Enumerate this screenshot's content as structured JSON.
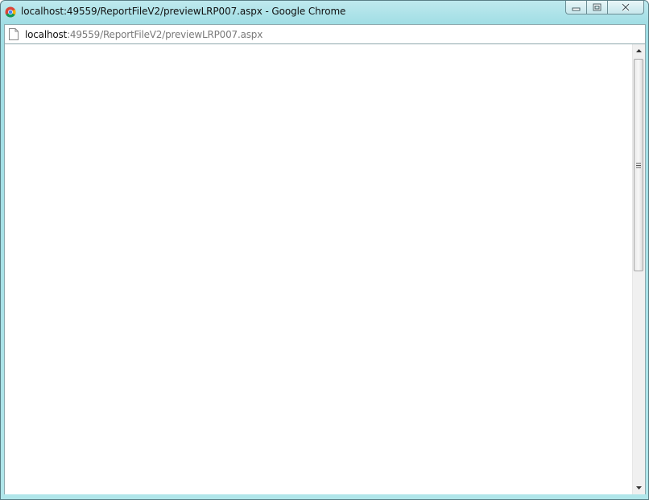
{
  "window": {
    "title": "localhost:49559/ReportFileV2/previewLRP007.aspx - Google Chrome",
    "app_icon": "chrome-logo-icon",
    "caption_buttons": [
      "minimize-icon",
      "maximize-icon",
      "close-icon"
    ]
  },
  "address_bar": {
    "icon": "page-icon",
    "url_host": "localhost",
    "url_path": ":49559/ReportFileV2/previewLRP007.aspx"
  },
  "content": {
    "scrollbar": {
      "icons": [
        "scroll-up-arrow-icon",
        "scroll-grip-icon",
        "scroll-down-arrow-icon"
      ]
    }
  },
  "colors": {
    "frame": "#b0e6ea",
    "url_host": "#111111",
    "url_path": "#7a7a7a"
  }
}
